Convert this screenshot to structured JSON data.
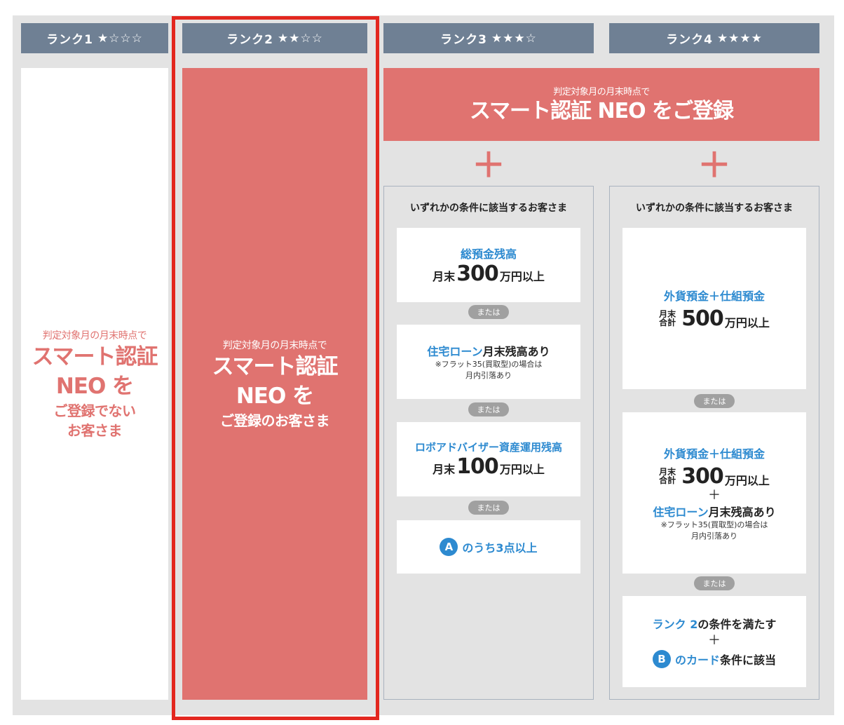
{
  "headers": [
    {
      "label": "ランク1",
      "stars": "★☆☆☆"
    },
    {
      "label": "ランク2",
      "stars": "★★☆☆"
    },
    {
      "label": "ランク3",
      "stars": "★★★☆"
    },
    {
      "label": "ランク4",
      "stars": "★★★★"
    }
  ],
  "rank1": {
    "line1": "判定対象月の月末時点で",
    "line2": "スマート認証",
    "line3": "NEO を",
    "line4": "ご登録でない",
    "line5": "お客さま"
  },
  "rank2": {
    "line1": "判定対象月の月末時点で",
    "line2": "スマート認証",
    "line3": "NEO を",
    "line4": "ご登録のお客さま"
  },
  "banner": {
    "line1": "判定対象月の月末時点で",
    "line2": "スマート認証 NEO をご登録"
  },
  "plus": "＋",
  "rank3": {
    "panel_title": "いずれかの条件に該当するお客さま",
    "or_label": "または",
    "card1": {
      "title": "総預金残高",
      "prefix": "月末",
      "amount": "300",
      "suffix": "万円以上"
    },
    "card2": {
      "title_blue": "住宅ローン",
      "title_black": "月末残高あり",
      "note1": "※フラット35(買取型)の場合は",
      "note2": "月内引落あり"
    },
    "card3": {
      "title": "ロボアドバイザー資産運用残高",
      "prefix": "月末",
      "amount": "100",
      "suffix": "万円以上"
    },
    "card4": {
      "badge": "A",
      "text": "のうち3点以上"
    }
  },
  "rank4": {
    "panel_title": "いずれかの条件に該当するお客さま",
    "or_label": "または",
    "card1": {
      "title": "外貨預金＋仕組預金",
      "stack1": "月末",
      "stack2": "合計",
      "amount": "500",
      "suffix": "万円以上"
    },
    "card2": {
      "title": "外貨預金＋仕組預金",
      "stack1": "月末",
      "stack2": "合計",
      "amount": "300",
      "suffix": "万円以上",
      "plus": "＋",
      "loan_blue": "住宅ローン",
      "loan_black": "月末残高あり",
      "note1": "※フラット35(買取型)の場合は",
      "note2": "月内引落あり"
    },
    "card3": {
      "rank_blue": "ランク 2",
      "rank_black": "の条件を満たす",
      "plus": "＋",
      "badge": "B",
      "card_blue": "のカード",
      "card_black": "条件に該当"
    }
  }
}
